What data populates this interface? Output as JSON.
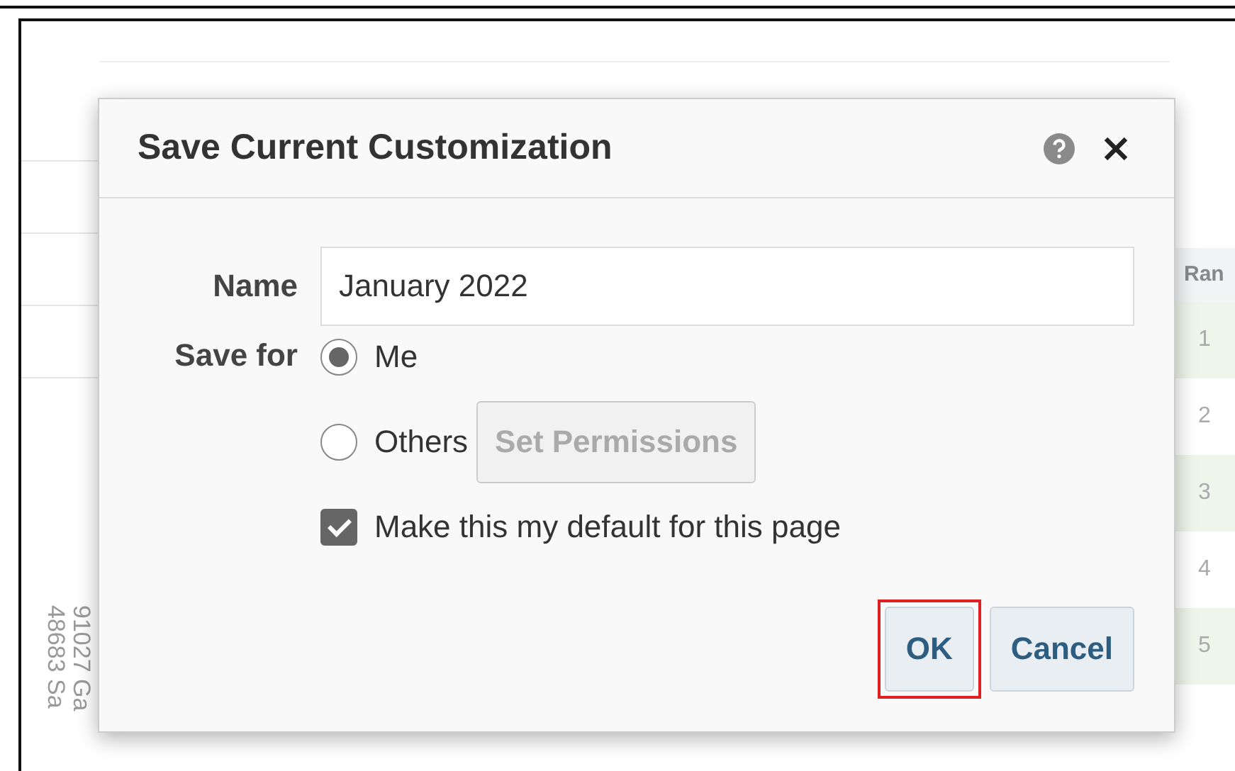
{
  "background": {
    "table_header": "Ran",
    "ranks": [
      "1",
      "2",
      "3",
      "4",
      "5"
    ],
    "axis_labels": [
      "48683 Sa",
      "91027 Ga"
    ]
  },
  "dialog": {
    "title": "Save Current Customization",
    "name_label": "Name",
    "name_value": "January 2022",
    "save_for_label": "Save for",
    "options": [
      {
        "label": "Me",
        "selected": true
      },
      {
        "label": "Others",
        "selected": false
      }
    ],
    "permissions_button": {
      "label": "Set Permissions",
      "disabled": true
    },
    "default_checkbox": {
      "label": "Make this my default for this page",
      "checked": true
    },
    "buttons": [
      {
        "label": "OK",
        "highlighted": true
      },
      {
        "label": "Cancel",
        "highlighted": false
      }
    ]
  }
}
